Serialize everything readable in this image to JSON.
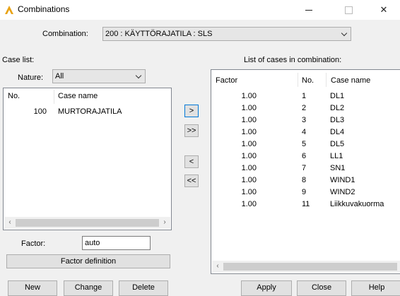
{
  "window": {
    "title": "Combinations"
  },
  "combination": {
    "label": "Combination:",
    "selected": "200 : KÄYTTÖRAJATILA : SLS"
  },
  "case_list": {
    "label": "Case list:",
    "nature_label": "Nature:",
    "nature_selected": "All",
    "columns": {
      "no": "No.",
      "name": "Case name"
    },
    "rows": [
      {
        "no": "100",
        "name": "MURTORAJATILA"
      }
    ]
  },
  "transfer": {
    "add": ">",
    "add_all": ">>",
    "remove": "<",
    "remove_all": "<<"
  },
  "factor": {
    "label": "Factor:",
    "value": "auto",
    "definition_button": "Factor definition"
  },
  "combo_cases": {
    "label": "List of cases in combination:",
    "columns": {
      "factor": "Factor",
      "no": "No.",
      "name": "Case name"
    },
    "rows": [
      {
        "factor": "1.00",
        "no": "1",
        "name": "DL1"
      },
      {
        "factor": "1.00",
        "no": "2",
        "name": "DL2"
      },
      {
        "factor": "1.00",
        "no": "3",
        "name": "DL3"
      },
      {
        "factor": "1.00",
        "no": "4",
        "name": "DL4"
      },
      {
        "factor": "1.00",
        "no": "5",
        "name": "DL5"
      },
      {
        "factor": "1.00",
        "no": "6",
        "name": "LL1"
      },
      {
        "factor": "1.00",
        "no": "7",
        "name": "SN1"
      },
      {
        "factor": "1.00",
        "no": "8",
        "name": "WIND1"
      },
      {
        "factor": "1.00",
        "no": "9",
        "name": "WIND2"
      },
      {
        "factor": "1.00",
        "no": "11",
        "name": "Liikkuvakuorma"
      }
    ]
  },
  "buttons": {
    "new": "New",
    "change": "Change",
    "delete": "Delete",
    "apply": "Apply",
    "close": "Close",
    "help": "Help"
  },
  "colors": {
    "focus": "#0078d7",
    "icon": "#e8a317"
  }
}
